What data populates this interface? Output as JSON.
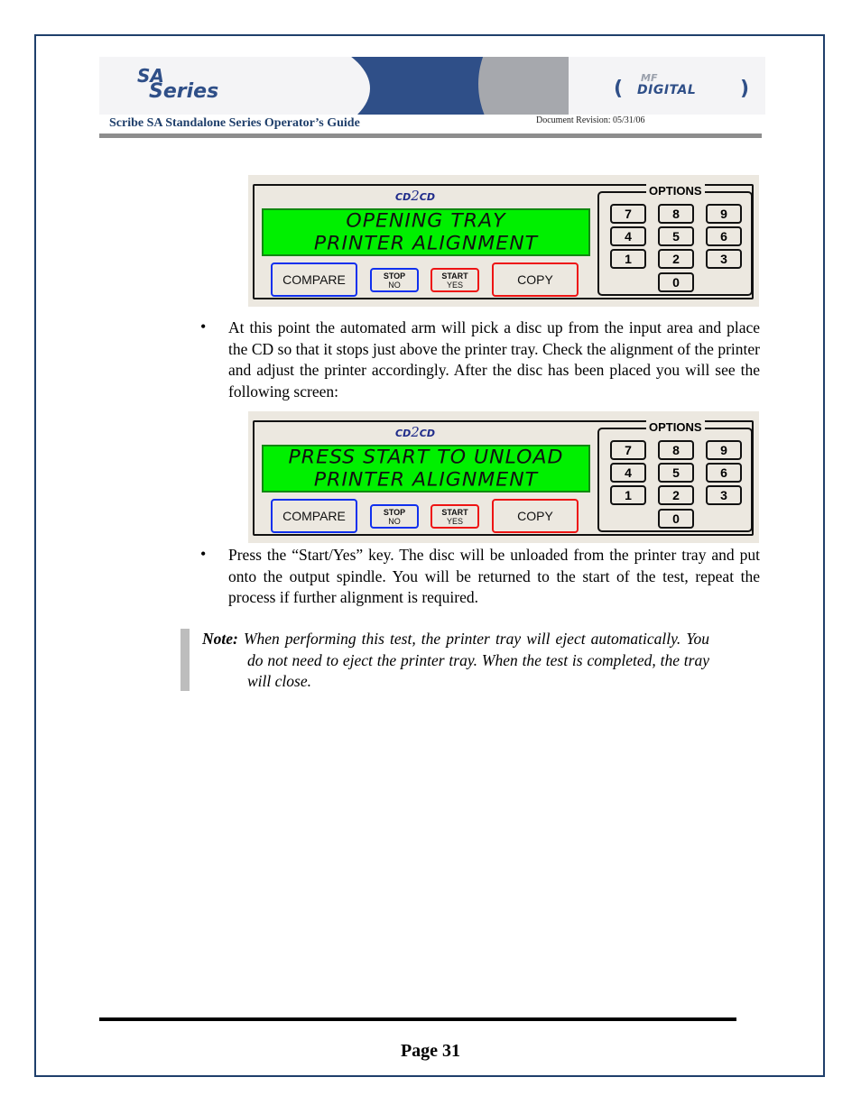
{
  "header": {
    "logo_left": {
      "line1": "SA",
      "line2": "Series"
    },
    "logo_right": {
      "top": "MF",
      "main": "DIGITAL"
    },
    "doc_title": "Scribe SA Standalone Series Operator’s Guide",
    "doc_revision": "Document Revision: 05/31/06"
  },
  "panels": [
    {
      "brand": {
        "left": "CD",
        "mid": "2",
        "right": "CD"
      },
      "lcd_lines": [
        "OPENING TRAY",
        "PRINTER ALIGNMENT"
      ],
      "buttons": {
        "compare": "COMPARE",
        "stop_top": "STOP",
        "stop_bottom": "NO",
        "start_top": "START",
        "start_bottom": "YES",
        "copy": "COPY"
      },
      "options_label": "OPTIONS",
      "keys": [
        "7",
        "8",
        "9",
        "4",
        "5",
        "6",
        "1",
        "2",
        "3",
        "0"
      ]
    },
    {
      "brand": {
        "left": "CD",
        "mid": "2",
        "right": "CD"
      },
      "lcd_lines": [
        "PRESS START TO UNLOAD",
        "PRINTER ALIGNMENT"
      ],
      "buttons": {
        "compare": "COMPARE",
        "stop_top": "STOP",
        "stop_bottom": "NO",
        "start_top": "START",
        "start_bottom": "YES",
        "copy": "COPY"
      },
      "options_label": "OPTIONS",
      "keys": [
        "7",
        "8",
        "9",
        "4",
        "5",
        "6",
        "1",
        "2",
        "3",
        "0"
      ]
    }
  ],
  "body": {
    "bullet_symbol": "•",
    "bullets": [
      "At this point the automated arm will pick a disc up from the input area and place the CD so that it stops just above the printer tray. Check the alignment of the printer and adjust the printer accordingly. After the disc has been placed you will see the following screen:",
      "Press the “Start/Yes” key. The disc will be unloaded from the printer tray and put onto the output spindle. You will be returned to the start of the test, repeat the process if further alignment is required."
    ],
    "note": {
      "label": "Note:",
      "text": "When performing this test, the printer tray will eject automatically.  You do not need to eject the printer tray. When the test is completed, the tray will close."
    }
  },
  "footer": {
    "page_label": "Page 31"
  },
  "colors": {
    "frame": "#1f3f6b",
    "lcd_green": "#00f000",
    "button_blue": "#1030ee",
    "button_red": "#ee1414",
    "brand_blue": "#2f4f88"
  }
}
